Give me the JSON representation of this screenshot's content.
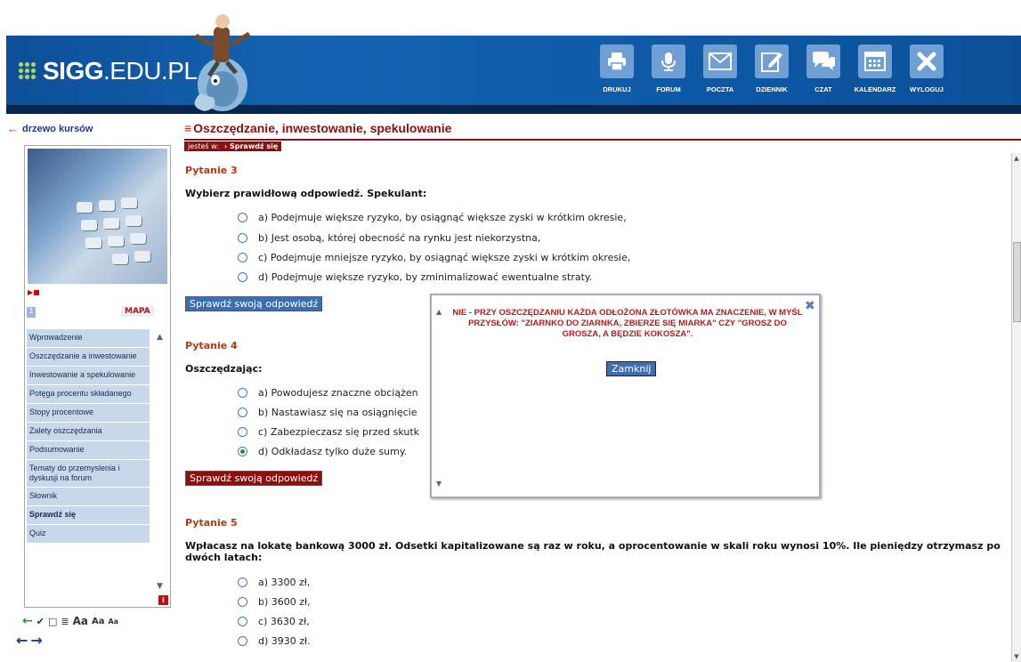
{
  "header": {
    "logo_main": "SIGG",
    "logo_rest": ".EDU.PL",
    "toolbar": [
      {
        "label": "DRUKUJ",
        "icon": "printer-icon"
      },
      {
        "label": "FORUM",
        "icon": "microphone-icon"
      },
      {
        "label": "POCZTA",
        "icon": "envelope-icon"
      },
      {
        "label": "DZIENNIK",
        "icon": "notepad-icon"
      },
      {
        "label": "CZAT",
        "icon": "chat-icon"
      },
      {
        "label": "KALENDARZ",
        "icon": "calendar-icon"
      },
      {
        "label": "WYLOGUJ",
        "icon": "close-icon"
      }
    ]
  },
  "sidebar": {
    "tree_link": "drzewo kursów",
    "page_num": "1",
    "mapa": "MAPA",
    "items": [
      {
        "label": "Wprowadzenie"
      },
      {
        "label": "Oszczędzanie a inwestowanie"
      },
      {
        "label": "Inwestowanie a spekulowanie"
      },
      {
        "label": "Potęga procentu składanego"
      },
      {
        "label": "Stopy procentowe"
      },
      {
        "label": "Zalety oszczędzania"
      },
      {
        "label": "Podsumowanie"
      },
      {
        "label": "Tematy do przemyslenia i dyskusji na forum"
      },
      {
        "label": "Słownik"
      },
      {
        "label": "Sprawdź się"
      },
      {
        "label": "Quiz"
      }
    ],
    "font_sizes": [
      "Aa",
      "Aa",
      "Aa"
    ]
  },
  "main": {
    "title": "Oszczędzanie, inwestowanie, spekulowanie",
    "breadcrumb_prefix": "jesteś w:",
    "breadcrumb_current": "Sprawdź się",
    "check_label": "Sprawdź swoją odpowiedź",
    "questions": [
      {
        "title": "Pytanie 3",
        "text": "Wybierz prawidłową odpowiedź. Spekulant:",
        "options": [
          "a) Podejmuje większe ryzyko, by osiągnąć większe zyski w krótkim okresie,",
          "b) Jest osobą, której obecność na rynku jest niekorzystna,",
          "c) Podejmuje mniejsze ryzyko, by osiągnąć większe zyski w krótkim okresie,",
          "d) Podejmuje większe ryzyko, by zminimalizować ewentualne straty."
        ]
      },
      {
        "title": "Pytanie 4",
        "text": "Oszczędzając:",
        "options": [
          "a) Powodujesz znaczne obciążen",
          "b) Nastawiasz się na osiągnięcie",
          "c) Zabezpieczasz się przed skutk",
          "d) Odkładasz tylko duże sumy."
        ],
        "selected": 3
      },
      {
        "title": "Pytanie 5",
        "text": "Wpłacasz na lokatę bankową 3000 zł. Odsetki kapitalizowane są raz w roku, a oprocentowanie w skali roku wynosi 10%. Ile pieniędzy otrzymasz po dwóch latach:",
        "options": [
          "a) 3300 zł,",
          "b) 3600 zł,",
          "c) 3630 zł,",
          "d) 3930 zł."
        ]
      }
    ]
  },
  "popup": {
    "message": "NIE - PRZY OSZCZĘDZANIU KAŻDA ODŁOŻONA ZŁOTÓWKA MA ZNACZENIE, W MYŚL PRZYSŁÓW: \"ZIARNKO DO ZIARNKA, ZBIERZE SIĘ MIARKA\" CZY \"GROSZ DO GROSZA, A BĘDZIE KOKOSZA\".",
    "close_label": "Zamknij"
  }
}
